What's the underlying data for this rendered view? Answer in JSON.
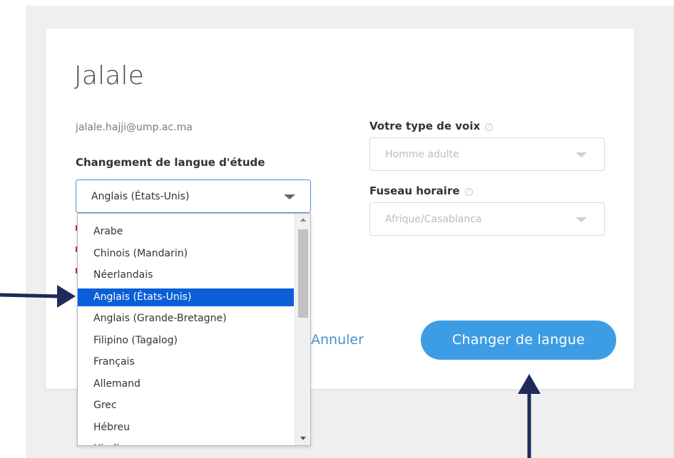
{
  "user": {
    "name": "Jalale",
    "email": "jalale.hajji@ump.ac.ma"
  },
  "study_language": {
    "label": "Changement de langue d'étude",
    "selected": "Anglais (États-Unis)",
    "options": [
      "Arabe",
      "Chinois (Mandarin)",
      "Néerlandais",
      "Anglais (États-Unis)",
      "Anglais (Grande-Bretagne)",
      "Filipino (Tagalog)",
      "Français",
      "Allemand",
      "Grec",
      "Hébreu",
      "Hindi"
    ],
    "highlighted_index": 3
  },
  "voice": {
    "label": "Votre type de voix",
    "value": "Homme adulte"
  },
  "timezone": {
    "label": "Fuseau horaire",
    "value": "Afrique/Casablanca"
  },
  "actions": {
    "cancel_label": "Annuler",
    "submit_label": "Changer de langue"
  },
  "colors": {
    "accent": "#3d9de4",
    "selection": "#0a5fd8",
    "annotation_arrow": "#1f2a5a"
  },
  "icons": {
    "help": "question-circle-icon",
    "dropdown": "caret-down-icon",
    "annotation": "arrow-icon"
  }
}
